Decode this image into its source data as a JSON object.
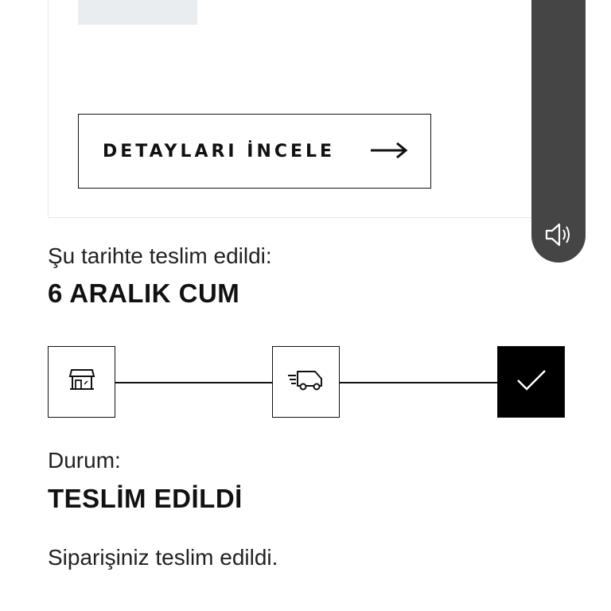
{
  "order_card": {
    "details_button_label": "DETAYLARI İNCELE",
    "arrow_icon": "arrow-right-icon"
  },
  "side_panel": {
    "volume_icon": "speaker-volume-icon"
  },
  "delivery": {
    "label": "Şu tarihte teslim edildi:",
    "date": "6 ARALIK CUM"
  },
  "tracker": {
    "steps": [
      {
        "icon": "store-icon",
        "active": false
      },
      {
        "icon": "delivery-truck-icon",
        "active": false
      },
      {
        "icon": "checkmark-icon",
        "active": true
      }
    ]
  },
  "status": {
    "label": "Durum:",
    "value": "TESLİM EDİLDİ",
    "message": "Siparişiniz teslim edildi."
  },
  "colors": {
    "panel": "#454545",
    "active_step": "#000000",
    "placeholder": "#e9edef"
  }
}
